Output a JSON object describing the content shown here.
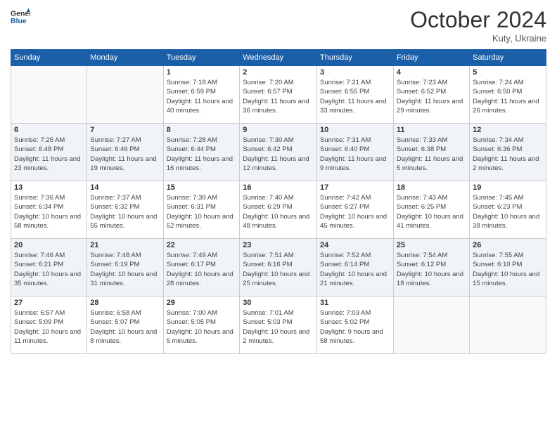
{
  "header": {
    "logo_line1": "General",
    "logo_line2": "Blue",
    "month_title": "October 2024",
    "subtitle": "Kuty, Ukraine"
  },
  "weekdays": [
    "Sunday",
    "Monday",
    "Tuesday",
    "Wednesday",
    "Thursday",
    "Friday",
    "Saturday"
  ],
  "weeks": [
    [
      {
        "day": "",
        "info": ""
      },
      {
        "day": "",
        "info": ""
      },
      {
        "day": "1",
        "info": "Sunrise: 7:18 AM\nSunset: 6:59 PM\nDaylight: 11 hours and 40 minutes."
      },
      {
        "day": "2",
        "info": "Sunrise: 7:20 AM\nSunset: 6:57 PM\nDaylight: 11 hours and 36 minutes."
      },
      {
        "day": "3",
        "info": "Sunrise: 7:21 AM\nSunset: 6:55 PM\nDaylight: 11 hours and 33 minutes."
      },
      {
        "day": "4",
        "info": "Sunrise: 7:23 AM\nSunset: 6:52 PM\nDaylight: 11 hours and 29 minutes."
      },
      {
        "day": "5",
        "info": "Sunrise: 7:24 AM\nSunset: 6:50 PM\nDaylight: 11 hours and 26 minutes."
      }
    ],
    [
      {
        "day": "6",
        "info": "Sunrise: 7:25 AM\nSunset: 6:48 PM\nDaylight: 11 hours and 23 minutes."
      },
      {
        "day": "7",
        "info": "Sunrise: 7:27 AM\nSunset: 6:46 PM\nDaylight: 11 hours and 19 minutes."
      },
      {
        "day": "8",
        "info": "Sunrise: 7:28 AM\nSunset: 6:44 PM\nDaylight: 11 hours and 16 minutes."
      },
      {
        "day": "9",
        "info": "Sunrise: 7:30 AM\nSunset: 6:42 PM\nDaylight: 11 hours and 12 minutes."
      },
      {
        "day": "10",
        "info": "Sunrise: 7:31 AM\nSunset: 6:40 PM\nDaylight: 11 hours and 9 minutes."
      },
      {
        "day": "11",
        "info": "Sunrise: 7:33 AM\nSunset: 6:38 PM\nDaylight: 11 hours and 5 minutes."
      },
      {
        "day": "12",
        "info": "Sunrise: 7:34 AM\nSunset: 6:36 PM\nDaylight: 11 hours and 2 minutes."
      }
    ],
    [
      {
        "day": "13",
        "info": "Sunrise: 7:36 AM\nSunset: 6:34 PM\nDaylight: 10 hours and 58 minutes."
      },
      {
        "day": "14",
        "info": "Sunrise: 7:37 AM\nSunset: 6:32 PM\nDaylight: 10 hours and 55 minutes."
      },
      {
        "day": "15",
        "info": "Sunrise: 7:39 AM\nSunset: 6:31 PM\nDaylight: 10 hours and 52 minutes."
      },
      {
        "day": "16",
        "info": "Sunrise: 7:40 AM\nSunset: 6:29 PM\nDaylight: 10 hours and 48 minutes."
      },
      {
        "day": "17",
        "info": "Sunrise: 7:42 AM\nSunset: 6:27 PM\nDaylight: 10 hours and 45 minutes."
      },
      {
        "day": "18",
        "info": "Sunrise: 7:43 AM\nSunset: 6:25 PM\nDaylight: 10 hours and 41 minutes."
      },
      {
        "day": "19",
        "info": "Sunrise: 7:45 AM\nSunset: 6:23 PM\nDaylight: 10 hours and 38 minutes."
      }
    ],
    [
      {
        "day": "20",
        "info": "Sunrise: 7:46 AM\nSunset: 6:21 PM\nDaylight: 10 hours and 35 minutes."
      },
      {
        "day": "21",
        "info": "Sunrise: 7:48 AM\nSunset: 6:19 PM\nDaylight: 10 hours and 31 minutes."
      },
      {
        "day": "22",
        "info": "Sunrise: 7:49 AM\nSunset: 6:17 PM\nDaylight: 10 hours and 28 minutes."
      },
      {
        "day": "23",
        "info": "Sunrise: 7:51 AM\nSunset: 6:16 PM\nDaylight: 10 hours and 25 minutes."
      },
      {
        "day": "24",
        "info": "Sunrise: 7:52 AM\nSunset: 6:14 PM\nDaylight: 10 hours and 21 minutes."
      },
      {
        "day": "25",
        "info": "Sunrise: 7:54 AM\nSunset: 6:12 PM\nDaylight: 10 hours and 18 minutes."
      },
      {
        "day": "26",
        "info": "Sunrise: 7:55 AM\nSunset: 6:10 PM\nDaylight: 10 hours and 15 minutes."
      }
    ],
    [
      {
        "day": "27",
        "info": "Sunrise: 6:57 AM\nSunset: 5:09 PM\nDaylight: 10 hours and 11 minutes."
      },
      {
        "day": "28",
        "info": "Sunrise: 6:58 AM\nSunset: 5:07 PM\nDaylight: 10 hours and 8 minutes."
      },
      {
        "day": "29",
        "info": "Sunrise: 7:00 AM\nSunset: 5:05 PM\nDaylight: 10 hours and 5 minutes."
      },
      {
        "day": "30",
        "info": "Sunrise: 7:01 AM\nSunset: 5:03 PM\nDaylight: 10 hours and 2 minutes."
      },
      {
        "day": "31",
        "info": "Sunrise: 7:03 AM\nSunset: 5:02 PM\nDaylight: 9 hours and 58 minutes."
      },
      {
        "day": "",
        "info": ""
      },
      {
        "day": "",
        "info": ""
      }
    ]
  ]
}
